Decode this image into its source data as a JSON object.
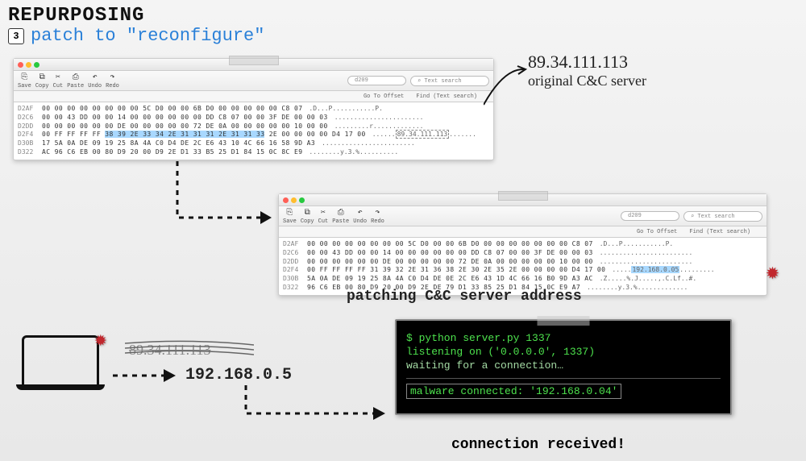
{
  "header": {
    "title": "REPURPOSING",
    "bullet": "3",
    "subtitle": "patch to \"reconfigure\""
  },
  "toolbar_labels": {
    "save": "Save",
    "copy": "Copy",
    "cut": "Cut",
    "paste": "Paste",
    "undo": "Undo",
    "redo": "Redo",
    "search_placeholder": "d209",
    "text_search": "Text search",
    "go_to_offset": "Go To Offset",
    "find": "Find (Text search)"
  },
  "hex1": {
    "rows": [
      {
        "addr": "D2AF",
        "bytes": "00 00 00 00 00 00 00 00 5C D0 00 00 6B D0 00 00 00 00 00 C8 07",
        "ascii": ".D...P...........P."
      },
      {
        "addr": "D2C6",
        "bytes": "00 00 43 DD 00 00 14 00 00 00 00 00 00 DD C8 07 00 00 3F DE 00 00 03",
        "ascii": "......................."
      },
      {
        "addr": "D2DD",
        "bytes": "00 00 00 00 00 00 DE 00 00 00 00 00 72 DE 0A 00 00 00 00 00 10 00 00",
        "ascii": ".........r............."
      },
      {
        "addr": "D2F4",
        "bytes": "00 FF FF FF FF",
        "h": "38 39 2E 33 34 2E 31 31 31 2E 31 31 33",
        "bytes2": "2E 00 00 00 00 D4 17 00",
        "ascii": "......",
        "boxed": "89.34.111.113",
        "ascii2": "......."
      },
      {
        "addr": "D30B",
        "bytes": "17 5A 0A DE 09 19 25 8A 4A C0 D4 DE 2C E6 43 10 4C 66 16 58 9D A3",
        "ascii": "........................"
      },
      {
        "addr": "D322",
        "bytes": "AC 96 C6 EB 00 80 D9 20 00 D9 2E D1 33 B5 25 D1 84 15 0C 8C E9",
        "ascii": "........y.3.%.........."
      }
    ]
  },
  "hex2": {
    "rows": [
      {
        "addr": "D2AF",
        "bytes": "00 00 00 00 00 00 00 00 5C D0 00 00 6B D0 00 00 00 00 00 00 00 C8 07",
        "ascii": ".D...P...........P."
      },
      {
        "addr": "D2C6",
        "bytes": "00 00 43 DD 00 00 14 00 00 00 00 00 00 DD C8 07 00 00 3F DE 00 00 03",
        "ascii": "........................"
      },
      {
        "addr": "D2DD",
        "bytes": "00 00 00 00 00 00 DE 00 00 00 00 00 72 DE 0A 00 00 00 00 00 10 00 00",
        "ascii": "........................"
      },
      {
        "addr": "D2F4",
        "bytes": "00 FF FF FF FF 31 39 32 2E 31 36 38 2E 30 2E 35 2E 00 00 00 00 D4 17 00",
        "ascii": ".....",
        "hlbox": "192.168.0.05",
        "ascii2": "........."
      },
      {
        "addr": "D30B",
        "bytes": "5A 0A DE 09 19 25 8A 4A C0 D4 DE 0E 2C E6 43 1D 4C 66 16 B0 9D A3 AC",
        "ascii": ".Z.....%.J.....,.C.Lf..#."
      },
      {
        "addr": "D322",
        "bytes": "96 C6 EB 00 80 D9 20 00 D9 2E DE 79 D1 33 85 25 D1 84 15 0C E9 A7",
        "ascii": "........y.3.%............."
      }
    ]
  },
  "annotations": {
    "original_ip": "89.34.111.113",
    "original_label": "original C&C server",
    "patching_caption": "patching C&C server address",
    "new_ip": "192.168.0.5",
    "connection_caption": "connection received!"
  },
  "terminal": {
    "cmd": "$ python server.py 1337",
    "listen": "listening on ('0.0.0.0', 1337)",
    "wait": "waiting for a connection…",
    "connected": "malware connected: '192.168.0.04'"
  }
}
